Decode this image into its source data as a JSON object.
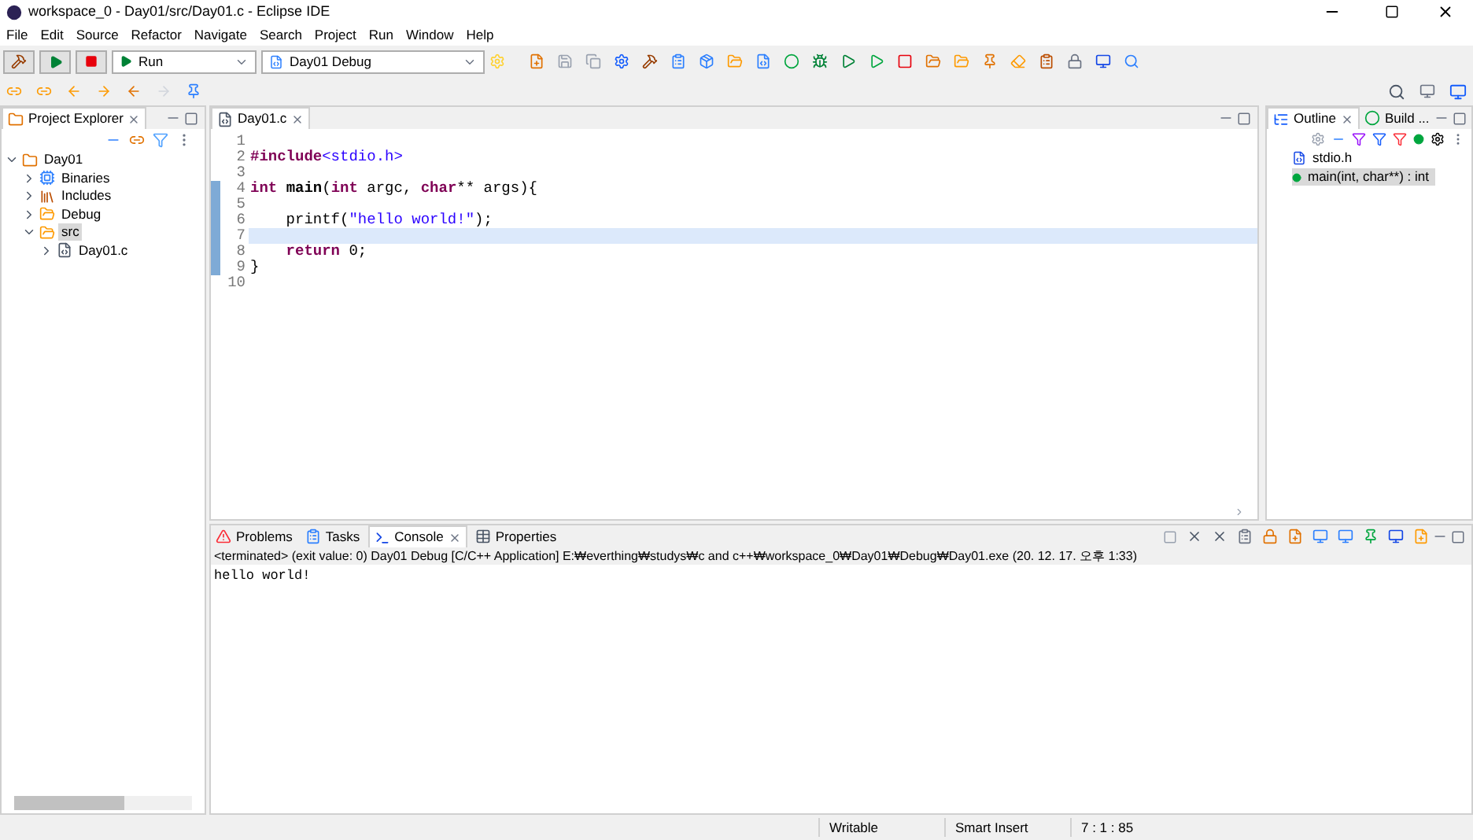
{
  "window": {
    "title": "workspace_0 - Day01/src/Day01.c - Eclipse IDE"
  },
  "menu": [
    "File",
    "Edit",
    "Source",
    "Refactor",
    "Navigate",
    "Search",
    "Project",
    "Run",
    "Window",
    "Help"
  ],
  "toolbar": {
    "run_mode": "Run",
    "launch_config": "Day01 Debug"
  },
  "project_explorer": {
    "title": "Project Explorer",
    "tree": [
      {
        "label": "Day01",
        "kind": "project",
        "expanded": true,
        "selected": false,
        "children": [
          {
            "label": "Binaries",
            "kind": "binaries",
            "expanded": false,
            "selected": false
          },
          {
            "label": "Includes",
            "kind": "includes",
            "expanded": false,
            "selected": false
          },
          {
            "label": "Debug",
            "kind": "folder",
            "expanded": false,
            "selected": false
          },
          {
            "label": "src",
            "kind": "folder",
            "expanded": true,
            "selected": true,
            "children": [
              {
                "label": "Day01.c",
                "kind": "file",
                "expanded": false,
                "selected": false
              }
            ]
          }
        ]
      }
    ]
  },
  "editor": {
    "tab": "Day01.c",
    "lines": [
      {
        "number": "1",
        "current": false
      },
      {
        "number": "2",
        "current": false,
        "tokens": [
          {
            "kind": "keyword",
            "text": "#include"
          },
          {
            "kind": "include",
            "text": "<stdio.h>"
          }
        ]
      },
      {
        "number": "3",
        "current": false
      },
      {
        "number": "4",
        "current": false,
        "tokens": [
          {
            "kind": "keyword",
            "text": "int "
          },
          {
            "kind": "bold",
            "text": "main"
          },
          {
            "kind": "plain",
            "text": "("
          },
          {
            "kind": "keyword",
            "text": "int"
          },
          {
            "kind": "plain",
            "text": " argc, "
          },
          {
            "kind": "keyword",
            "text": "char"
          },
          {
            "kind": "plain",
            "text": "** args){"
          }
        ]
      },
      {
        "number": "5",
        "current": false
      },
      {
        "number": "6",
        "current": false,
        "tokens": [
          {
            "kind": "plain",
            "text": "    printf("
          },
          {
            "kind": "string",
            "text": "\"hello world!\""
          },
          {
            "kind": "plain",
            "text": ");"
          }
        ]
      },
      {
        "number": "7",
        "current": true
      },
      {
        "number": "8",
        "current": false,
        "tokens": [
          {
            "kind": "keyword",
            "text": "    return "
          },
          {
            "kind": "plain",
            "text": "0;"
          }
        ]
      },
      {
        "number": "9",
        "current": false,
        "tokens": [
          {
            "kind": "plain",
            "text": "}"
          }
        ]
      },
      {
        "number": "10",
        "current": false
      }
    ]
  },
  "outline": {
    "tabs": [
      {
        "label": "Outline",
        "selected": true
      },
      {
        "label": "Build ...",
        "selected": false
      }
    ],
    "items": [
      {
        "label": "stdio.h",
        "kind": "include",
        "selected": false
      },
      {
        "label": "main(int, char**) : int",
        "kind": "function",
        "selected": true
      }
    ]
  },
  "console": {
    "tabs": [
      {
        "label": "Problems",
        "selected": false
      },
      {
        "label": "Tasks",
        "selected": false
      },
      {
        "label": "Console",
        "selected": true
      },
      {
        "label": "Properties",
        "selected": false
      }
    ],
    "header": "<terminated> (exit value: 0) Day01 Debug [C/C++ Application] E:₩everthing₩studys₩c and c++₩workspace_0₩Day01₩Debug₩Day01.exe (20. 12. 17. 오후 1:33)",
    "output": "hello world!"
  },
  "status_bar": [
    "Writable",
    "Smart Insert",
    "7 : 1 : 85"
  ]
}
